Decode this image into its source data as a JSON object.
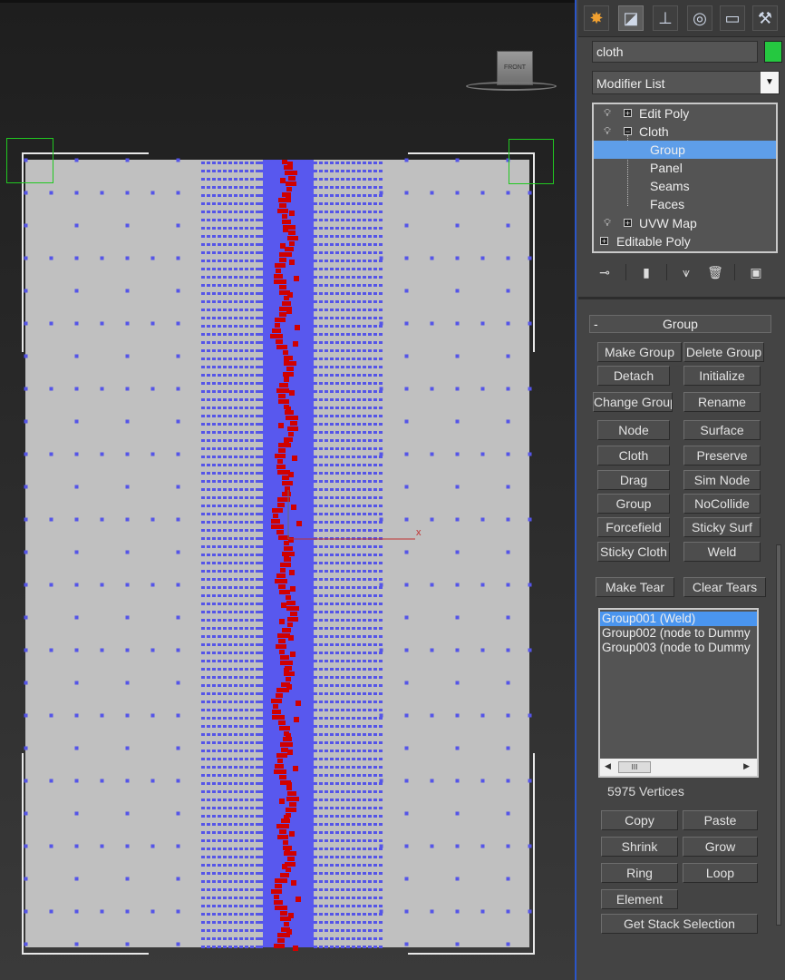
{
  "viewport": {
    "viewcube_label": "FRONT",
    "axis_label": "x",
    "colors": {
      "sheet": "#c0c0c0",
      "vertex": "#5555e8",
      "selection": "#5858ee",
      "weld": "#d00000",
      "frame": "#e8e8e8",
      "corner_box": "#21c821",
      "axis": "#c03030"
    }
  },
  "command_panel": {
    "tabs": [
      {
        "icon": "create-icon",
        "glyph": "✸"
      },
      {
        "icon": "modify-icon",
        "glyph": "◪"
      },
      {
        "icon": "hierarchy-icon",
        "glyph": "⊥"
      },
      {
        "icon": "motion-icon",
        "glyph": "◎"
      },
      {
        "icon": "display-icon",
        "glyph": "▭"
      },
      {
        "icon": "utilities-icon",
        "glyph": "⚒"
      }
    ],
    "object_name": "cloth",
    "object_color": "#25c840",
    "modifier_list": "Modifier List",
    "stack": [
      {
        "label": "Edit Poly",
        "expander": "+",
        "bulb": true
      },
      {
        "label": "Cloth",
        "expander": "−",
        "bulb": true
      },
      {
        "label": "Group",
        "sub": true
      },
      {
        "label": "Panel",
        "sub": true
      },
      {
        "label": "Seams",
        "sub": true
      },
      {
        "label": "Faces",
        "sub": true
      },
      {
        "label": "UVW Map",
        "expander": "+",
        "bulb": true
      },
      {
        "label": "Editable Poly",
        "expander": "+",
        "bulb": false
      }
    ],
    "toolbar_icons": [
      "pin-stack-icon",
      "show-end-result-icon",
      "make-unique-icon",
      "remove-modifier-icon",
      "configure-modifier-sets-icon"
    ]
  },
  "group_rollout": {
    "title": "Group",
    "collapse_symbol": "-",
    "buttons": {
      "make_group": "Make Group",
      "delete_group": "Delete Group",
      "detach": "Detach",
      "initialize": "Initialize",
      "change_group": "Change Group",
      "rename": "Rename",
      "node": "Node",
      "surface": "Surface",
      "cloth": "Cloth",
      "preserve": "Preserve",
      "drag": "Drag",
      "sim_node": "Sim Node",
      "group": "Group",
      "nocollide": "NoCollide",
      "forcefield": "Forcefield",
      "sticky_surf": "Sticky Surf",
      "sticky_cloth": "Sticky Cloth",
      "weld": "Weld",
      "make_tear": "Make Tear",
      "clear_tears": "Clear Tears"
    },
    "groups": [
      "Group001 (Weld)",
      "Group002 (node  to  Dummy",
      "Group003 (node  to  Dummy"
    ],
    "scroll_thumb": "III",
    "vertex_count": "5975 Vertices",
    "selection_buttons": {
      "copy": "Copy",
      "paste": "Paste",
      "shrink": "Shrink",
      "grow": "Grow",
      "ring": "Ring",
      "loop": "Loop",
      "element": "Element",
      "get_stack_selection": "Get Stack Selection"
    }
  }
}
